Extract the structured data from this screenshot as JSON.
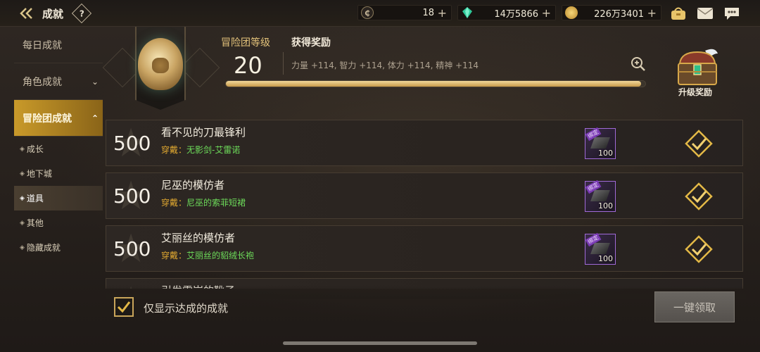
{
  "topbar": {
    "back_icon": "back-arrow-icon",
    "title": "成就",
    "help_label": "?",
    "currencies": [
      {
        "icon": "coin-c-icon",
        "value": "18",
        "plus": "+"
      },
      {
        "icon": "green-gem-icon",
        "value": "14万5866",
        "plus": "+"
      },
      {
        "icon": "gold-coin-icon",
        "value": "226万3401",
        "plus": "+"
      }
    ],
    "icons": [
      "inventory-bag-icon",
      "mail-icon",
      "chat-icon"
    ]
  },
  "sidebar": {
    "items": [
      {
        "label": "每日成就"
      },
      {
        "label": "角色成就",
        "chevron": "⌄"
      },
      {
        "label": "冒险团成就",
        "chevron": "⌃"
      }
    ],
    "sub_items": [
      {
        "label": "成长"
      },
      {
        "label": "地下城"
      },
      {
        "label": "道具"
      },
      {
        "label": "其他"
      },
      {
        "label": "隐藏成就"
      }
    ]
  },
  "header": {
    "level_label": "冒险团等级",
    "level_value": "20",
    "reward_title": "获得奖励",
    "reward_stats": "力量 +114, 智力 +114, 体力 +114, 精神 +114",
    "progress": 0.99,
    "chest_label": "升级奖励"
  },
  "achievements": [
    {
      "points": "500",
      "name": "看不见的刀最锋利",
      "equip_label": "穿戴：",
      "equip_value": "无影剑-艾雷诺",
      "item_tag": "绑定",
      "item_qty": "100"
    },
    {
      "points": "500",
      "name": "尼巫的模仿者",
      "equip_label": "穿戴：",
      "equip_value": "尼巫的索菲短裙",
      "item_tag": "绑定",
      "item_qty": "100"
    },
    {
      "points": "500",
      "name": "艾丽丝的模仿者",
      "equip_label": "穿戴：",
      "equip_value": "艾丽丝的貂绒长袍",
      "item_tag": "绑定",
      "item_qty": "100"
    },
    {
      "points": "",
      "name": "引发雪崩的靴子",
      "equip_label": "",
      "equip_value": "",
      "item_tag": "",
      "item_qty": ""
    }
  ],
  "footer": {
    "checkbox_label": "仅显示达成的成就",
    "checkbox_checked": true,
    "claim_button": "一键领取"
  },
  "colors": {
    "accent_gold": "#c99a2a",
    "equip_label": "#e0a830",
    "equip_value": "#6ddc5a",
    "item_border": "#a06ad8"
  }
}
